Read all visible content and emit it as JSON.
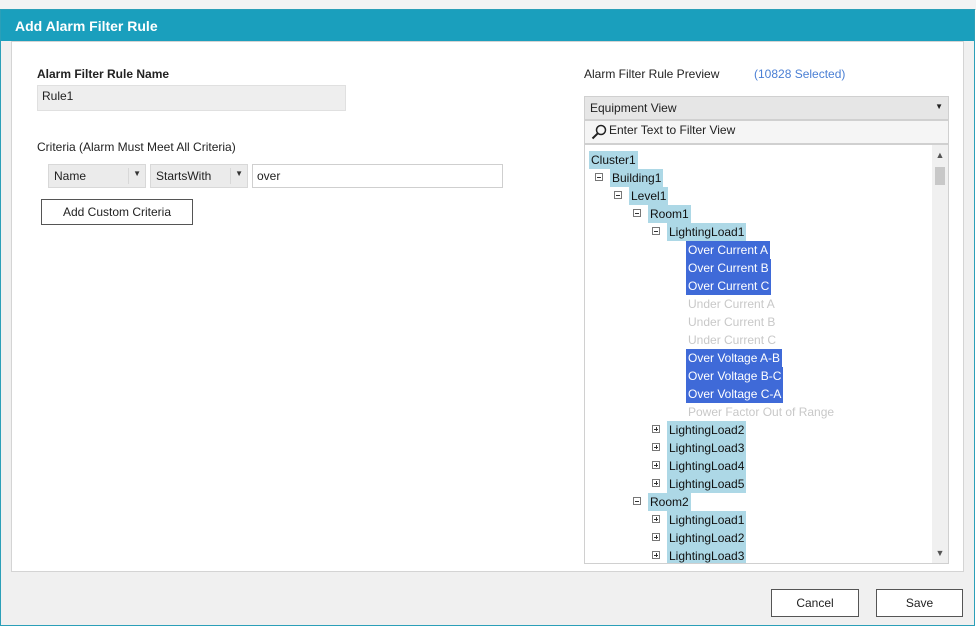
{
  "dialog": {
    "title": "Add Alarm Filter Rule",
    "cancel_label": "Cancel",
    "save_label": "Save"
  },
  "rule": {
    "name_label": "Alarm Filter Rule Name",
    "name_value": "Rule1"
  },
  "criteria": {
    "heading": "Criteria (Alarm Must Meet All Criteria)",
    "field_value": "Name",
    "operator_value": "StartsWith",
    "text_value": "over",
    "add_button_label": "Add Custom Criteria"
  },
  "preview": {
    "heading": "Alarm Filter Rule Preview",
    "selected_count": "(10828 Selected)",
    "view_value": "Equipment View",
    "filter_placeholder": "Enter Text to Filter View",
    "tree": [
      {
        "label": "Cluster1",
        "state": "light",
        "expander": "none",
        "level": 0
      },
      {
        "label": "Building1",
        "state": "light",
        "expander": "minus",
        "level": 1
      },
      {
        "label": "Level1",
        "state": "light",
        "expander": "minus",
        "level": 2
      },
      {
        "label": "Room1",
        "state": "light",
        "expander": "minus",
        "level": 3
      },
      {
        "label": "LightingLoad1",
        "state": "light",
        "expander": "minus",
        "level": 4
      },
      {
        "label": "Over Current A",
        "state": "selected",
        "expander": "none",
        "level": 5
      },
      {
        "label": "Over Current B",
        "state": "selected",
        "expander": "none",
        "level": 5
      },
      {
        "label": "Over Current C",
        "state": "selected",
        "expander": "none",
        "level": 5
      },
      {
        "label": "Under Current A",
        "state": "dimmed",
        "expander": "none",
        "level": 5
      },
      {
        "label": "Under Current B",
        "state": "dimmed",
        "expander": "none",
        "level": 5
      },
      {
        "label": "Under Current C",
        "state": "dimmed",
        "expander": "none",
        "level": 5
      },
      {
        "label": "Over Voltage A-B",
        "state": "selected",
        "expander": "none",
        "level": 5
      },
      {
        "label": "Over Voltage B-C",
        "state": "selected",
        "expander": "none",
        "level": 5
      },
      {
        "label": "Over Voltage C-A",
        "state": "selected",
        "expander": "none",
        "level": 5
      },
      {
        "label": "Power Factor Out of Range",
        "state": "dimmed",
        "expander": "none",
        "level": 5
      },
      {
        "label": "LightingLoad2",
        "state": "light",
        "expander": "plus",
        "level": 4
      },
      {
        "label": "LightingLoad3",
        "state": "light",
        "expander": "plus",
        "level": 4
      },
      {
        "label": "LightingLoad4",
        "state": "light",
        "expander": "plus",
        "level": 4
      },
      {
        "label": "LightingLoad5",
        "state": "light",
        "expander": "plus",
        "level": 4
      },
      {
        "label": "Room2",
        "state": "light",
        "expander": "minus",
        "level": 3
      },
      {
        "label": "LightingLoad1",
        "state": "light",
        "expander": "plus",
        "level": 4
      },
      {
        "label": "LightingLoad2",
        "state": "light",
        "expander": "plus",
        "level": 4
      },
      {
        "label": "LightingLoad3",
        "state": "light",
        "expander": "plus",
        "level": 4
      }
    ]
  },
  "colors": {
    "titlebar": "#1a9fbd",
    "selection": "#3f6ad8",
    "node_highlight": "#add8e6",
    "count_text": "#4a7fd4"
  }
}
